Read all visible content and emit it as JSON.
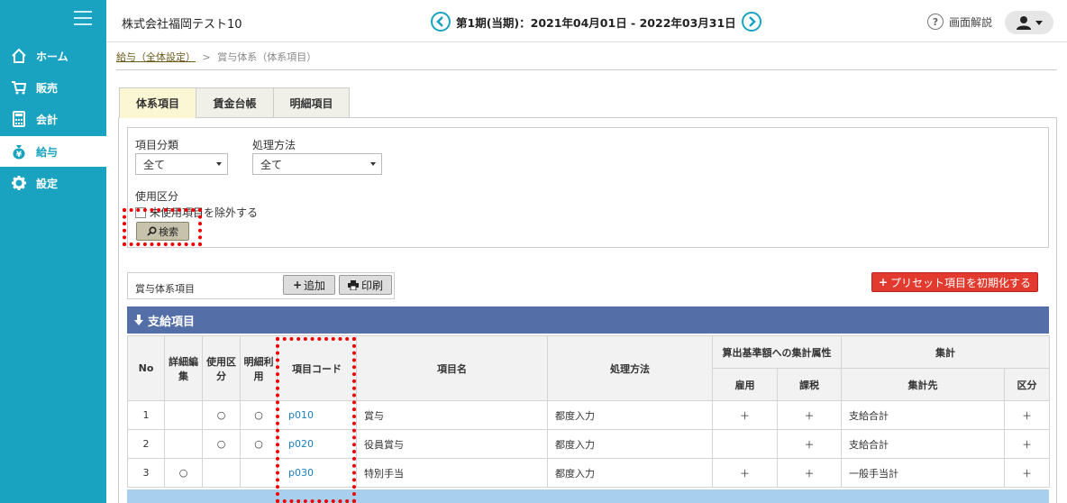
{
  "app": {
    "company": "株式会社福岡テスト10",
    "period": "第1期(当期)：2021年04月01日 - 2022年03月31日",
    "help_label": "画面解説"
  },
  "sidebar": {
    "items": [
      {
        "label": "ホーム",
        "icon": "home-icon"
      },
      {
        "label": "販売",
        "icon": "cart-icon"
      },
      {
        "label": "会計",
        "icon": "calculator-icon"
      },
      {
        "label": "給与",
        "icon": "money-bag-icon",
        "active": true
      },
      {
        "label": "設定",
        "icon": "gear-icon"
      }
    ]
  },
  "breadcrumb": {
    "link": "給与（全体設定）",
    "sep": ">",
    "current": "賞与体系（体系項目）"
  },
  "tabs": [
    "体系項目",
    "賃金台帳",
    "明細項目"
  ],
  "search": {
    "category_label": "項目分類",
    "category_value": "全て",
    "method_label": "処理方法",
    "method_value": "全て",
    "usage_label": "使用区分",
    "exclude_unused_label": "未使用項目を除外する",
    "search_button": "検索"
  },
  "toolbar": {
    "title": "賞与体系項目",
    "add_button": "追加",
    "print_button": "印刷",
    "preset_button": "プリセット項目を初期化する"
  },
  "section": {
    "title": "支給項目"
  },
  "table": {
    "headers": {
      "no": "No",
      "detail_edit": "詳細編集",
      "usage": "使用区分",
      "detail_use": "明細利用",
      "code": "項目コード",
      "name": "項目名",
      "method": "処理方法",
      "attr_group": "算出基準額への集計属性",
      "employment": "雇用",
      "taxable": "課税",
      "sum_group": "集計",
      "sum_target": "集計先",
      "division": "区分"
    },
    "rows": [
      {
        "no": "1",
        "detail_edit": "",
        "usage": "○",
        "detail_use": "○",
        "code": "p010",
        "name": "賞与",
        "method": "都度入力",
        "employment": "＋",
        "taxable": "＋",
        "sum_target": "支給合計",
        "division": "＋"
      },
      {
        "no": "2",
        "detail_edit": "",
        "usage": "○",
        "detail_use": "○",
        "code": "p020",
        "name": "役員賞与",
        "method": "都度入力",
        "employment": "",
        "taxable": "＋",
        "sum_target": "支給合計",
        "division": "＋"
      },
      {
        "no": "3",
        "detail_edit": "○",
        "usage": "",
        "detail_use": "",
        "code": "p030",
        "name": "特別手当",
        "method": "都度入力",
        "employment": "＋",
        "taxable": "＋",
        "sum_target": "一般手当計",
        "division": "＋"
      }
    ]
  }
}
